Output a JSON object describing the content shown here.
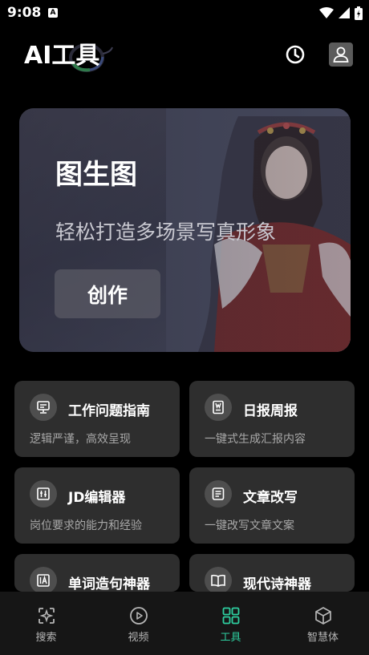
{
  "status_bar": {
    "time": "9:08",
    "notification_badge": "A"
  },
  "header": {
    "title": "AI工具",
    "history_icon": "clock-icon",
    "profile_icon": "user-icon"
  },
  "banner": {
    "title": "图生图",
    "subtitle": "轻松打造多场景写真形象",
    "button_label": "创作"
  },
  "tools": [
    {
      "title": "工作问题指南",
      "desc": "逻辑严谨，高效呈现",
      "icon": "monitor-icon"
    },
    {
      "title": "日报周报",
      "desc": "一键式生成汇报内容",
      "icon": "report-icon"
    },
    {
      "title": "JD编辑器",
      "desc": "岗位要求的能力和经验",
      "icon": "edit-document-icon"
    },
    {
      "title": "文章改写",
      "desc": "一键改写文章文案",
      "icon": "article-icon"
    },
    {
      "title": "单词造句神器",
      "desc": "",
      "icon": "word-icon"
    },
    {
      "title": "现代诗神器",
      "desc": "",
      "icon": "book-icon"
    }
  ],
  "bottom_nav": {
    "items": [
      {
        "label": "搜索",
        "icon": "search-sparkle-icon",
        "active": false
      },
      {
        "label": "视频",
        "icon": "play-icon",
        "active": false
      },
      {
        "label": "工具",
        "icon": "grid-icon",
        "active": true
      },
      {
        "label": "智慧体",
        "icon": "cube-icon",
        "active": false
      }
    ]
  },
  "colors": {
    "accent": "#2ecfa0",
    "card_bg": "#2e2e2e",
    "background": "#000000"
  }
}
